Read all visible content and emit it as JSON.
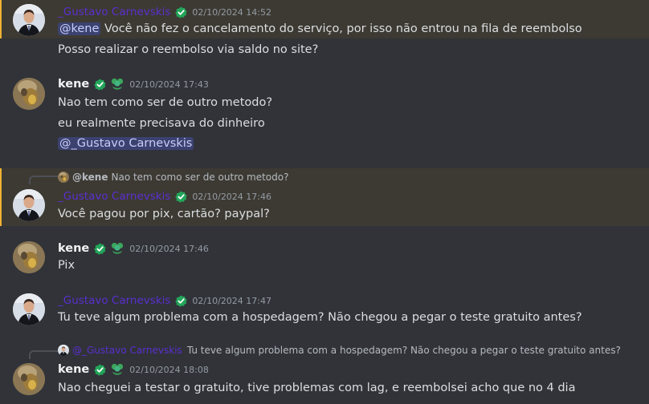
{
  "colors": {
    "background": "#313338",
    "highlight": "#3d3a33",
    "highlight_bar": "#f0b232",
    "gustavo_name": "#5a2fd0",
    "mention_bg": "#3c4270",
    "verified": "#23a55a"
  },
  "users": {
    "gustavo": {
      "name": "_Gustavo Carnevskis"
    },
    "kene": {
      "name": "kene"
    }
  },
  "messages": [
    {
      "timestamp": "02/10/2024 14:52",
      "mention": "@kene",
      "lines": [
        "Você não fez o cancelamento do serviço, por isso não entrou na fila de reembolso",
        "Posso realizar o reembolso via saldo no site?"
      ]
    },
    {
      "timestamp": "02/10/2024 17:43",
      "lines": [
        "Nao tem como ser de outro metodo?",
        "eu realmente precisava do dinheiro"
      ],
      "mention": "@_Gustavo Carnevskis"
    },
    {
      "reply": {
        "name": "@kene",
        "text": "Nao tem como ser de outro metodo?"
      },
      "timestamp": "02/10/2024 17:46",
      "lines": [
        "Você pagou por pix, cartão? paypal?"
      ]
    },
    {
      "timestamp": "02/10/2024 17:46",
      "lines": [
        "Pix"
      ]
    },
    {
      "timestamp": "02/10/2024 17:47",
      "lines": [
        "Tu teve algum problema com a hospedagem? Não chegou a pegar o teste gratuito antes?"
      ]
    },
    {
      "reply": {
        "name": "@_Gustavo Carnevskis",
        "text": "Tu teve algum problema com a hospedagem? Não chegou a pegar o teste gratuito antes?"
      },
      "timestamp": "02/10/2024 18:08",
      "lines": [
        "Nao cheguei a testar o gratuito, tive problemas com lag, e reembolsei acho que no 4 dia"
      ]
    }
  ]
}
